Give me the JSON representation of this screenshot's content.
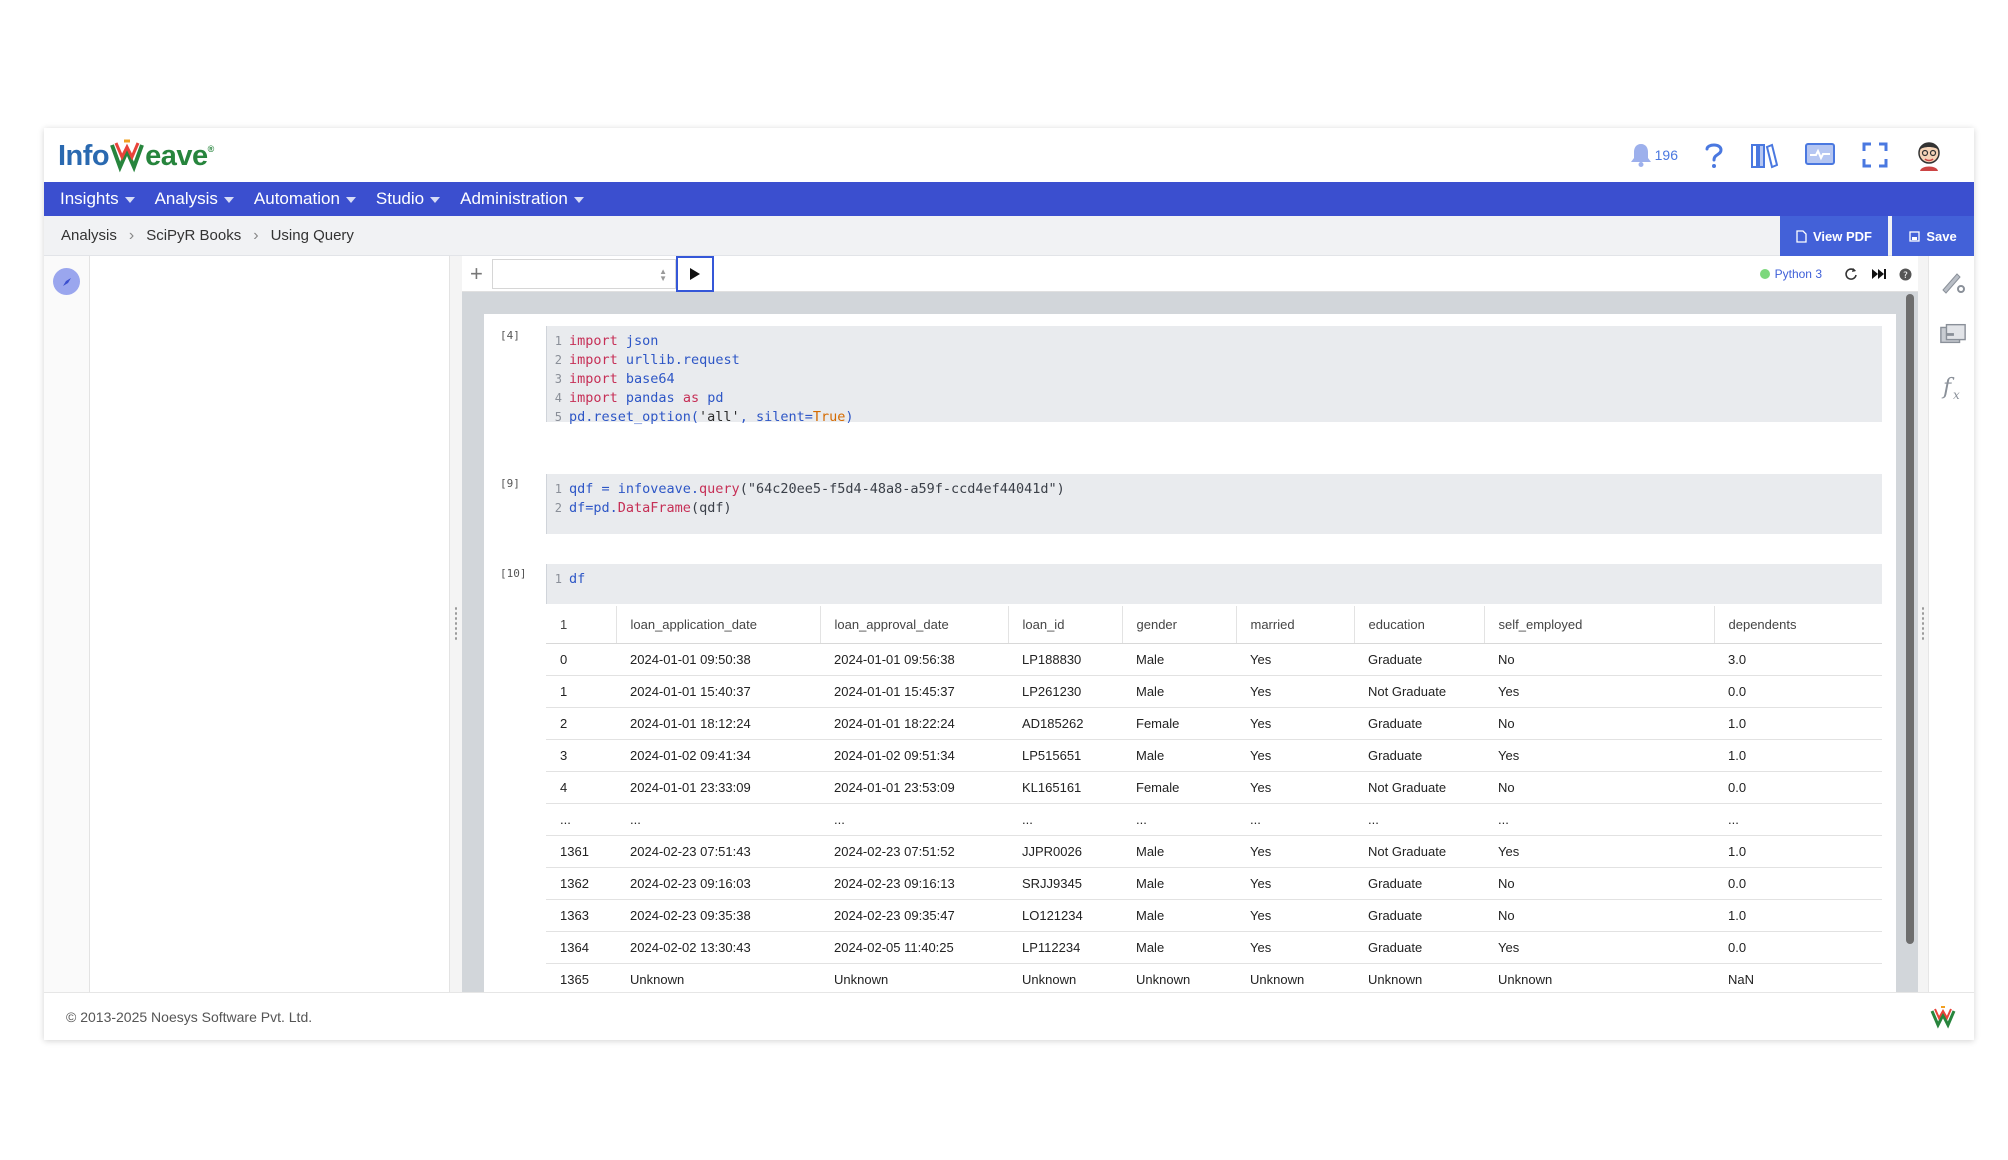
{
  "brand": {
    "part1": "Info",
    "part2": "eave",
    "trademark": "®"
  },
  "header": {
    "notification_count": "196"
  },
  "nav": [
    "Insights",
    "Analysis",
    "Automation",
    "Studio",
    "Administration"
  ],
  "breadcrumb": [
    "Analysis",
    "SciPyR Books",
    "Using Query"
  ],
  "actions": {
    "view_pdf": "View PDF",
    "save": "Save"
  },
  "toolbar": {
    "kernel": "Python 3"
  },
  "cells": [
    {
      "label": "[4]",
      "lines": [
        [
          {
            "t": "import",
            "c": "kw"
          },
          {
            "t": " "
          },
          {
            "t": "json",
            "c": "nm"
          }
        ],
        [
          {
            "t": "import",
            "c": "kw"
          },
          {
            "t": " "
          },
          {
            "t": "urllib.request",
            "c": "nm"
          }
        ],
        [
          {
            "t": "import",
            "c": "kw"
          },
          {
            "t": " "
          },
          {
            "t": "base64",
            "c": "nm"
          }
        ],
        [
          {
            "t": "import",
            "c": "kw"
          },
          {
            "t": " "
          },
          {
            "t": "pandas",
            "c": "nm"
          },
          {
            "t": " "
          },
          {
            "t": "as",
            "c": "kw"
          },
          {
            "t": " "
          },
          {
            "t": "pd",
            "c": "nm"
          }
        ],
        [
          {
            "t": "pd.reset_option(",
            "c": "nm"
          },
          {
            "t": "'all'",
            "c": "str"
          },
          {
            "t": ", silent=",
            "c": "nm"
          },
          {
            "t": "True",
            "c": "tr"
          },
          {
            "t": ")",
            "c": "nm"
          }
        ]
      ]
    },
    {
      "label": "[9]",
      "lines": [
        [
          {
            "t": "qdf = infoveave.",
            "c": "nm"
          },
          {
            "t": "query",
            "c": "kw"
          },
          {
            "t": "(\"64c20ee5-f5d4-48a8-a59f-ccd4ef44041d\")",
            "c": "pl"
          }
        ],
        [
          {
            "t": "df=pd.",
            "c": "nm"
          },
          {
            "t": "DataFrame",
            "c": "kw"
          },
          {
            "t": "(qdf)",
            "c": "pl"
          }
        ]
      ]
    },
    {
      "label": "[10]",
      "lines": [
        [
          {
            "t": "df",
            "c": "nm"
          }
        ]
      ]
    }
  ],
  "table": {
    "columns": [
      "1",
      "loan_application_date",
      "loan_approval_date",
      "loan_id",
      "gender",
      "married",
      "education",
      "self_employed",
      "dependents"
    ],
    "rows": [
      [
        "0",
        "2024-01-01 09:50:38",
        "2024-01-01 09:56:38",
        "LP188830",
        "Male",
        "Yes",
        "Graduate",
        "No",
        "3.0"
      ],
      [
        "1",
        "2024-01-01 15:40:37",
        "2024-01-01 15:45:37",
        "LP261230",
        "Male",
        "Yes",
        "Not Graduate",
        "Yes",
        "0.0"
      ],
      [
        "2",
        "2024-01-01 18:12:24",
        "2024-01-01 18:22:24",
        "AD185262",
        "Female",
        "Yes",
        "Graduate",
        "No",
        "1.0"
      ],
      [
        "3",
        "2024-01-02 09:41:34",
        "2024-01-02 09:51:34",
        "LP515651",
        "Male",
        "Yes",
        "Graduate",
        "Yes",
        "1.0"
      ],
      [
        "4",
        "2024-01-01 23:33:09",
        "2024-01-01 23:53:09",
        "KL165161",
        "Female",
        "Yes",
        "Not Graduate",
        "No",
        "0.0"
      ],
      [
        "...",
        "...",
        "...",
        "...",
        "...",
        "...",
        "...",
        "...",
        "..."
      ],
      [
        "1361",
        "2024-02-23 07:51:43",
        "2024-02-23 07:51:52",
        "JJPR0026",
        "Male",
        "Yes",
        "Not Graduate",
        "Yes",
        "1.0"
      ],
      [
        "1362",
        "2024-02-23 09:16:03",
        "2024-02-23 09:16:13",
        "SRJJ9345",
        "Male",
        "Yes",
        "Graduate",
        "No",
        "0.0"
      ],
      [
        "1363",
        "2024-02-23 09:35:38",
        "2024-02-23 09:35:47",
        "LO121234",
        "Male",
        "Yes",
        "Graduate",
        "No",
        "1.0"
      ],
      [
        "1364",
        "2024-02-02 13:30:43",
        "2024-02-05 11:40:25",
        "LP112234",
        "Male",
        "Yes",
        "Graduate",
        "Yes",
        "0.0"
      ],
      [
        "1365",
        "Unknown",
        "Unknown",
        "Unknown",
        "Unknown",
        "Unknown",
        "Unknown",
        "Unknown",
        "NaN"
      ]
    ]
  },
  "footer": {
    "copyright": "© 2013-2025 Noesys Software Pvt. Ltd."
  },
  "icons": {
    "bell": "bell-icon",
    "help": "help-icon",
    "library": "library-icon",
    "monitor": "monitor-icon",
    "fullscreen": "fullscreen-icon",
    "avatar": "avatar",
    "compass": "compass-icon",
    "restart": "restart-icon",
    "run_all": "run-all-icon",
    "info": "info-icon",
    "brush": "brush-settings-icon",
    "archive": "archive-icon",
    "function": "function-icon"
  },
  "colors": {
    "primary": "#3b4fcf",
    "button": "#4361d8",
    "keyword": "#c62f56",
    "name": "#2d56c6",
    "boolean": "#d46a00",
    "kernel_ok": "#7dd87d"
  }
}
